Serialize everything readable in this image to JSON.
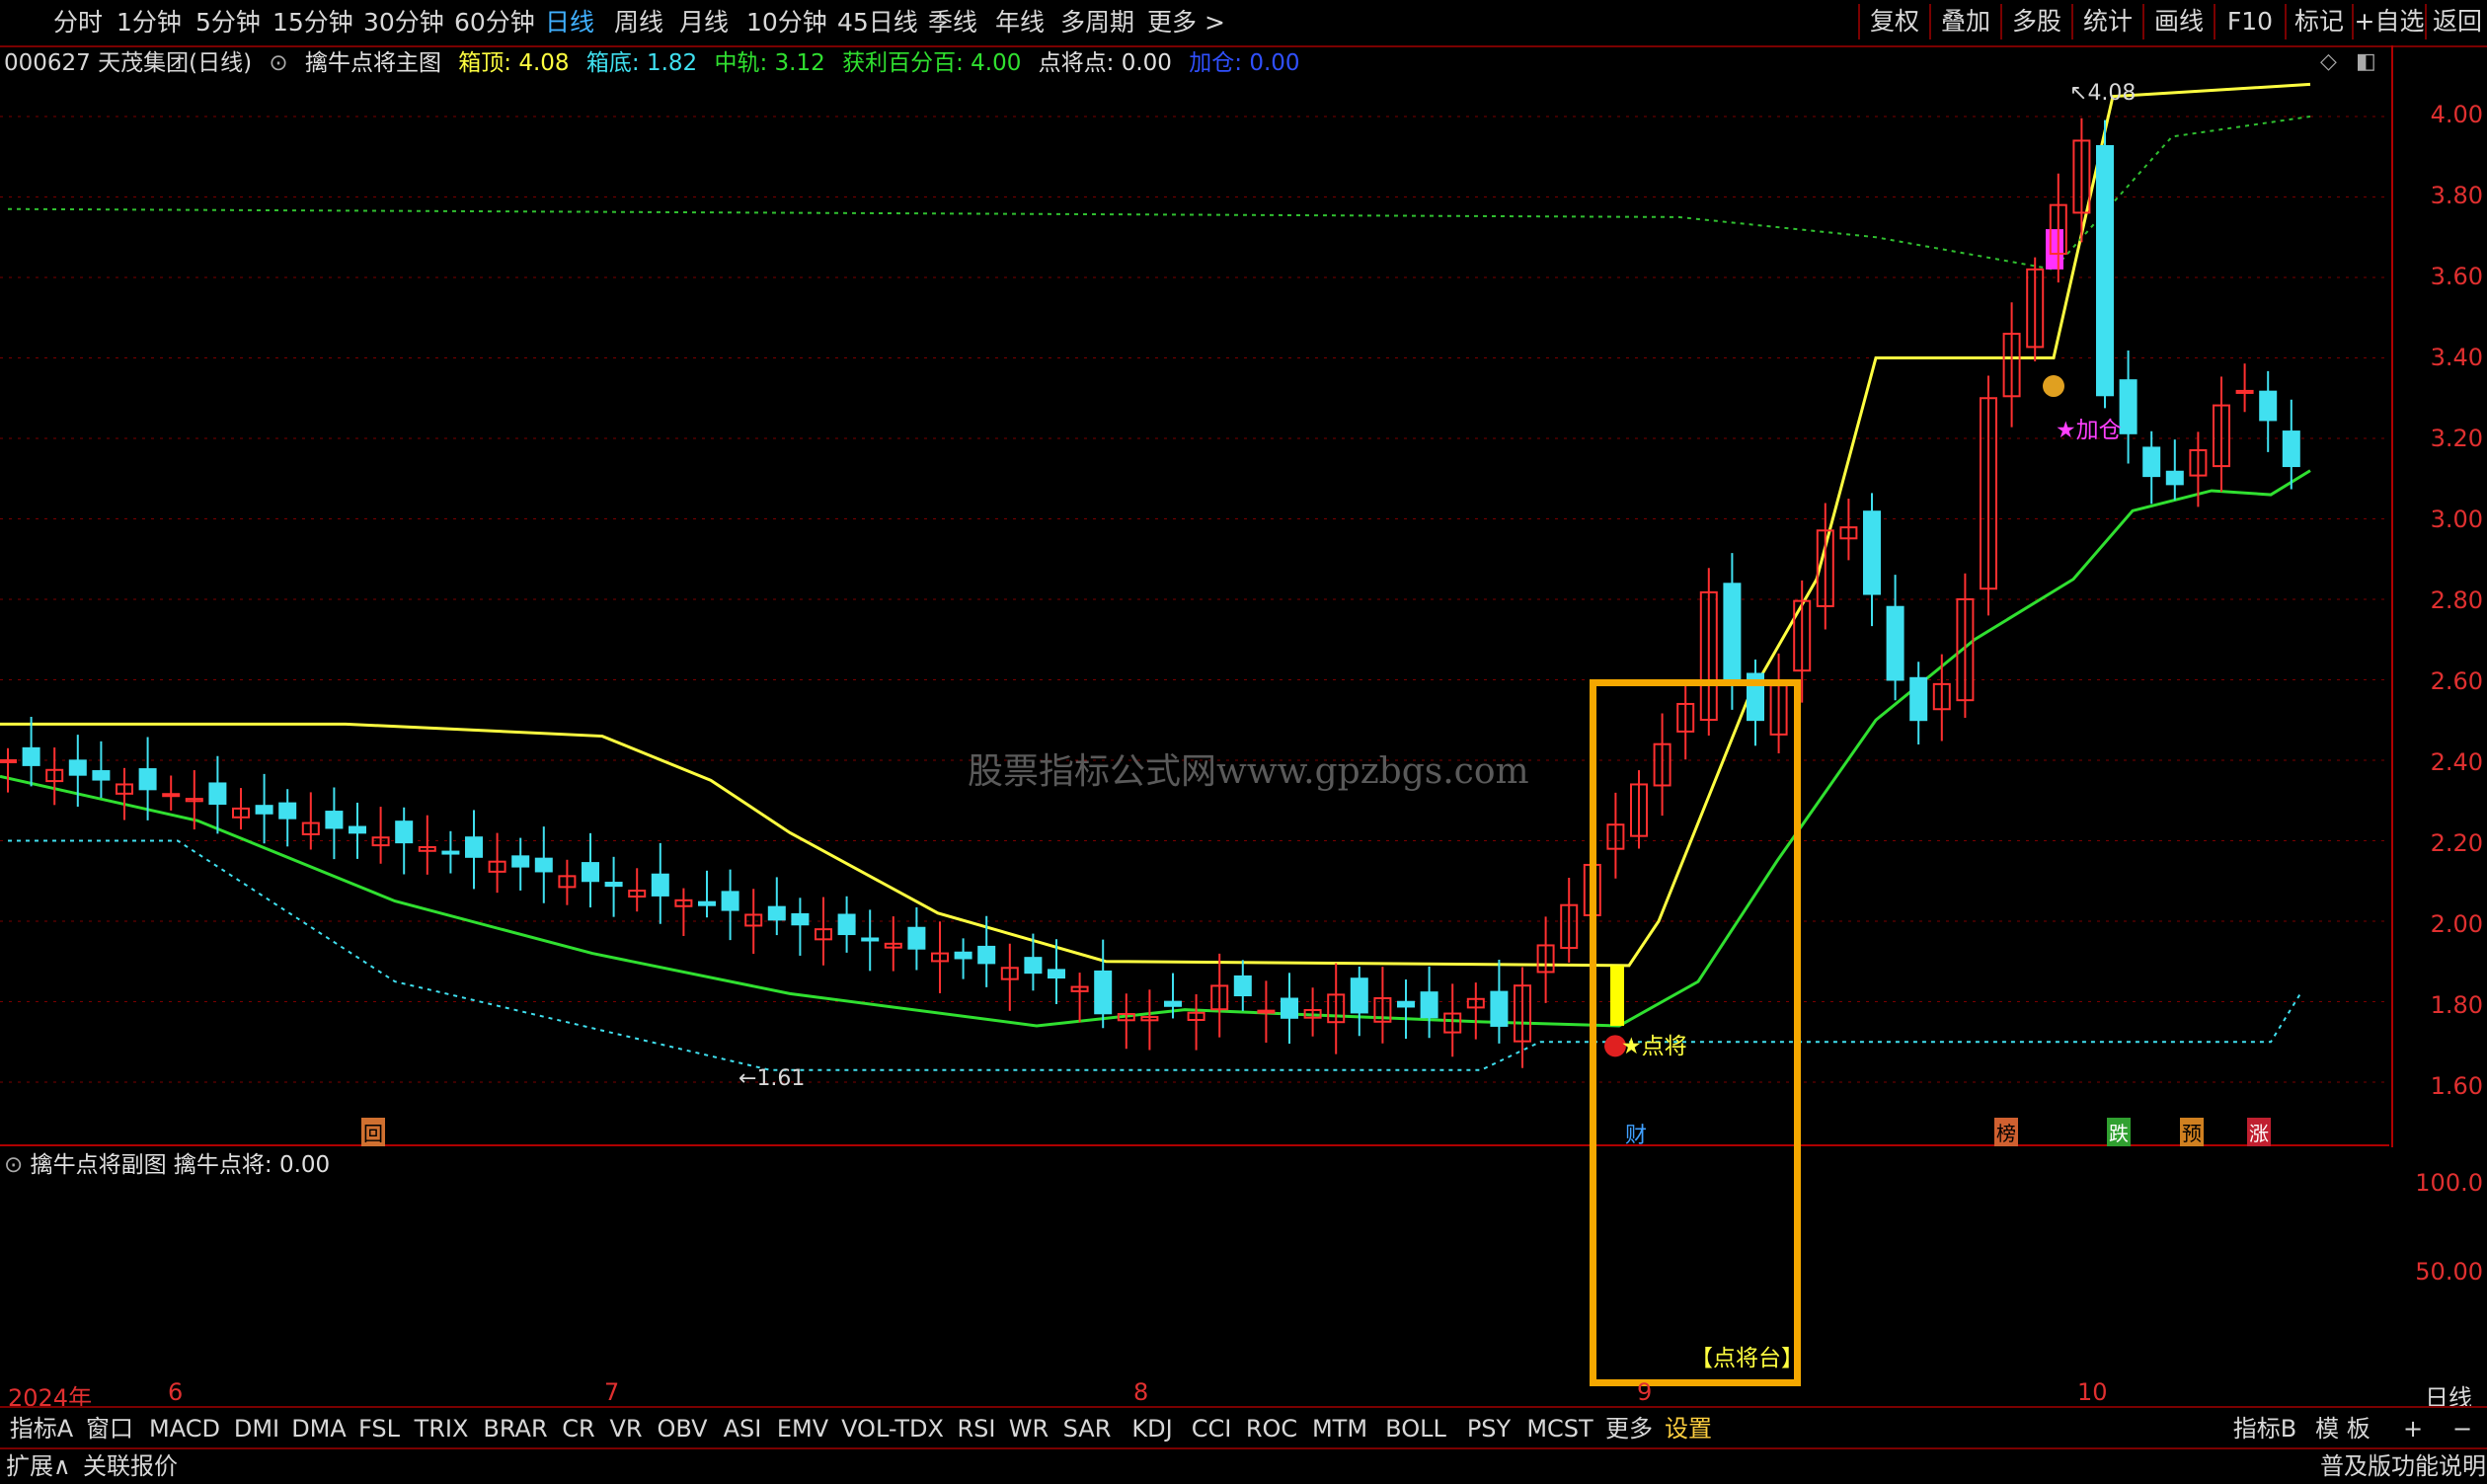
{
  "periods": [
    "分时",
    "1分钟",
    "5分钟",
    "15分钟",
    "30分钟",
    "60分钟",
    "日线",
    "周线",
    "月线",
    "10分钟",
    "45日线",
    "季线",
    "年线",
    "多周期",
    "更多 >"
  ],
  "active_period": "日线",
  "right_buttons": [
    "复权",
    "叠加",
    "多股",
    "统计",
    "画线",
    "F10",
    "标记",
    "+自选",
    "返回"
  ],
  "info": {
    "stock": "000627 天茂集团(日线)",
    "indicator": "擒牛点将主图",
    "top_label": "箱顶:",
    "top_val": "4.08",
    "bottom_label": "箱底:",
    "bottom_val": "1.82",
    "mid_label": "中轨:",
    "mid_val": "3.12",
    "profit_label": "获利百分百:",
    "profit_val": "4.00",
    "point_label": "点将点:",
    "point_val": "0.00",
    "add_label": "加仓:",
    "add_val": "0.00"
  },
  "price_axis": [
    "4.00",
    "3.80",
    "3.60",
    "3.40",
    "3.20",
    "3.00",
    "2.80",
    "2.60",
    "2.40",
    "2.20",
    "2.00",
    "1.80",
    "1.60"
  ],
  "sub_axis": [
    "100.0",
    "50.00"
  ],
  "sub_title": {
    "name": "擒牛点将副图",
    "label": "擒牛点将:",
    "value": "0.00"
  },
  "date_labels": [
    "2024年",
    "6",
    "7",
    "8",
    "9",
    "10"
  ],
  "axis_mode": "日线",
  "annotations": {
    "high": "4.08",
    "low": "1.61",
    "dianjiang": "★点将",
    "jiacang": "★加仓",
    "dianjiangtai": "【点将台】",
    "markers": [
      "回",
      "财",
      "榜",
      "跌",
      "预",
      "涨"
    ]
  },
  "watermark": "股票指标公式网www.gpzbgs.com",
  "bottom_tabs": [
    "指标A",
    "窗口",
    "MACD",
    "DMI",
    "DMA",
    "FSL",
    "TRIX",
    "BRAR",
    "CR",
    "VR",
    "OBV",
    "ASI",
    "EMV",
    "VOL-TDX",
    "RSI",
    "WR",
    "SAR",
    "KDJ",
    "CCI",
    "ROC",
    "MTM",
    "BOLL",
    "PSY",
    "MCST",
    "更多",
    "设置"
  ],
  "bottom_right": [
    "指标B",
    "模 板",
    "+",
    "−"
  ],
  "status": [
    "扩展∧",
    "关联报价",
    "普及版功能说明"
  ],
  "colors": {
    "up": "#ff3030",
    "down": "#40e0f0",
    "box_top": "#ffff40",
    "mid": "#30e030",
    "highlight": "#f5a800"
  }
}
